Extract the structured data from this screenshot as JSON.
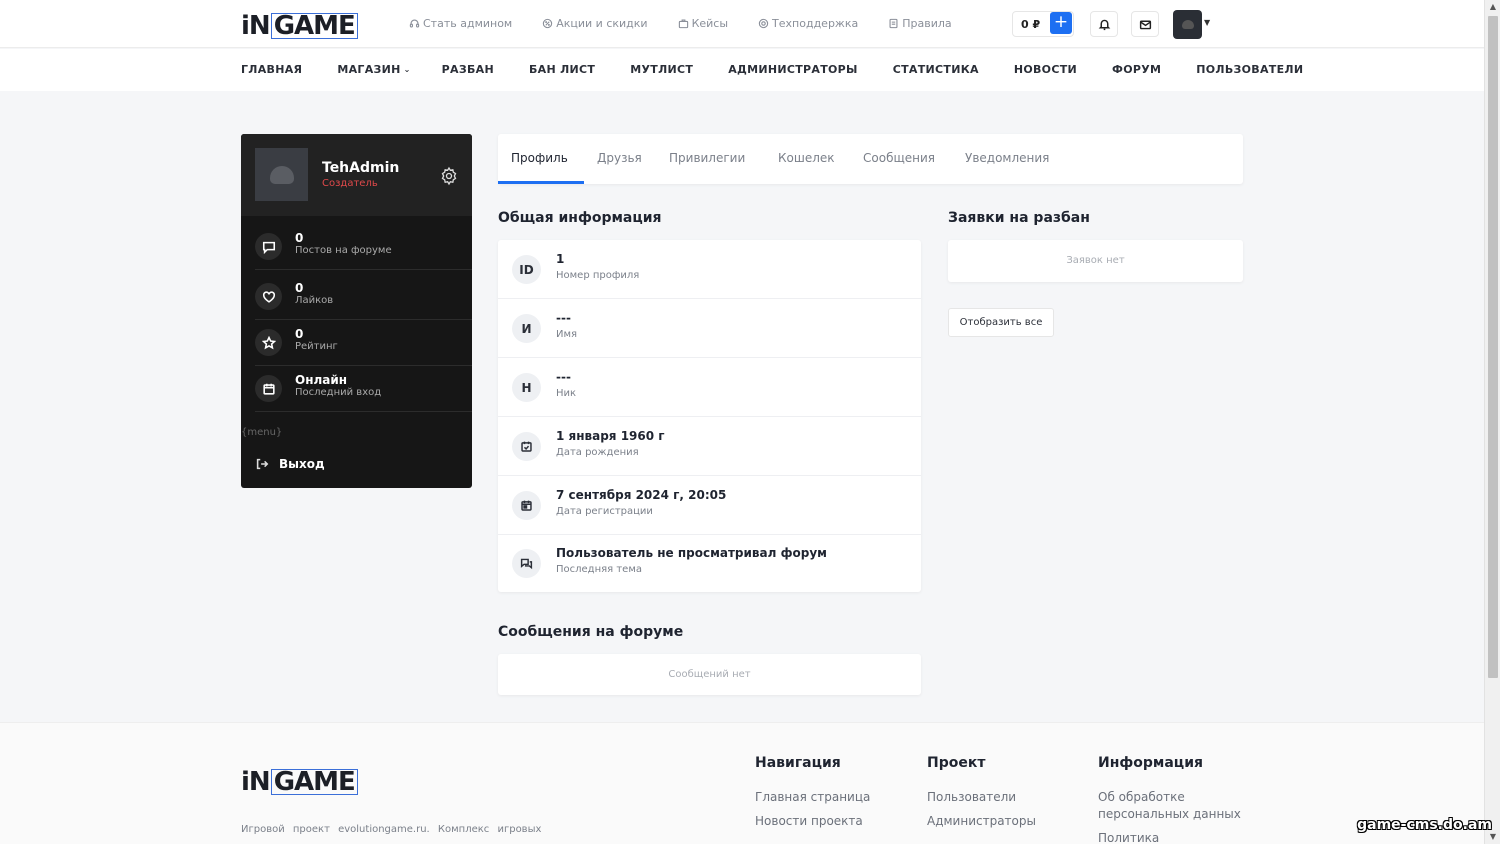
{
  "header": {
    "logo_text": "iNGAME",
    "top_links": [
      {
        "label": "Стать админом",
        "icon": "headset-icon"
      },
      {
        "label": "Акции и скидки",
        "icon": "discount-icon"
      },
      {
        "label": "Кейсы",
        "icon": "case-icon"
      },
      {
        "label": "Техподдержка",
        "icon": "support-icon"
      },
      {
        "label": "Правила",
        "icon": "rules-icon"
      }
    ],
    "balance": "0 ₽",
    "add_funds_label": "+"
  },
  "nav": {
    "items": [
      "ГЛАВНАЯ",
      "МАГАЗИН",
      "РАЗБАН",
      "БАН ЛИСТ",
      "МУТЛИСТ",
      "АДМИНИСТРАТОРЫ",
      "СТАТИСТИКА",
      "НОВОСТИ",
      "ФОРУМ",
      "ПОЛЬЗОВАТЕЛИ"
    ]
  },
  "profile": {
    "username": "TehAdmin",
    "role": "Создатель",
    "role_color": "#e0494a",
    "stats": [
      {
        "value": "0",
        "label": "Постов на форуме",
        "icon": "comment-icon"
      },
      {
        "value": "0",
        "label": "Лайков",
        "icon": "heart-icon"
      },
      {
        "value": "0",
        "label": "Рейтинг",
        "icon": "star-icon"
      },
      {
        "value": "Онлайн",
        "label": "Последний вход",
        "icon": "calendar-icon"
      }
    ],
    "menu_placeholder": "{menu}",
    "logout_label": "Выход"
  },
  "tabs": [
    "Профиль",
    "Друзья",
    "Привилегии",
    "Кошелек",
    "Сообщения",
    "Уведомления"
  ],
  "general": {
    "title": "Общая информация",
    "rows": [
      {
        "badge": "ID",
        "value": "1",
        "label": "Номер профиля"
      },
      {
        "badge": "И",
        "value": "---",
        "label": "Имя"
      },
      {
        "badge": "Н",
        "value": "---",
        "label": "Ник"
      },
      {
        "badge": "",
        "value": "1 января 1960 г",
        "label": "Дата рождения",
        "icon": "calendar-check-icon"
      },
      {
        "badge": "",
        "value": "7 сентября 2024 г, 20:05",
        "label": "Дата регистрации",
        "icon": "calendar-icon"
      },
      {
        "badge": "",
        "value": "Пользователь не просматривал форум",
        "label": "Последняя тема",
        "icon": "chat-icon"
      }
    ]
  },
  "unban": {
    "title": "Заявки на разбан",
    "empty": "Заявок нет",
    "show_all": "Отобразить все"
  },
  "forum": {
    "title": "Сообщения на форуме",
    "empty": "Сообщений нет"
  },
  "footer": {
    "logo_text": "iNGAME",
    "description": "Игровой проект evolutiongame.ru. Комплекс игровых",
    "columns": [
      {
        "title": "Навигация",
        "links": [
          "Главная страница",
          "Новости проекта"
        ]
      },
      {
        "title": "Проект",
        "links": [
          "Пользователи",
          "Администраторы"
        ]
      },
      {
        "title": "Информация",
        "links": [
          "Об обработке персональных данных",
          "Политика"
        ]
      }
    ]
  },
  "watermark": "game-cms.do.am",
  "colors": {
    "accent": "#1d6ff2",
    "sidebar_bg": "#161616"
  }
}
